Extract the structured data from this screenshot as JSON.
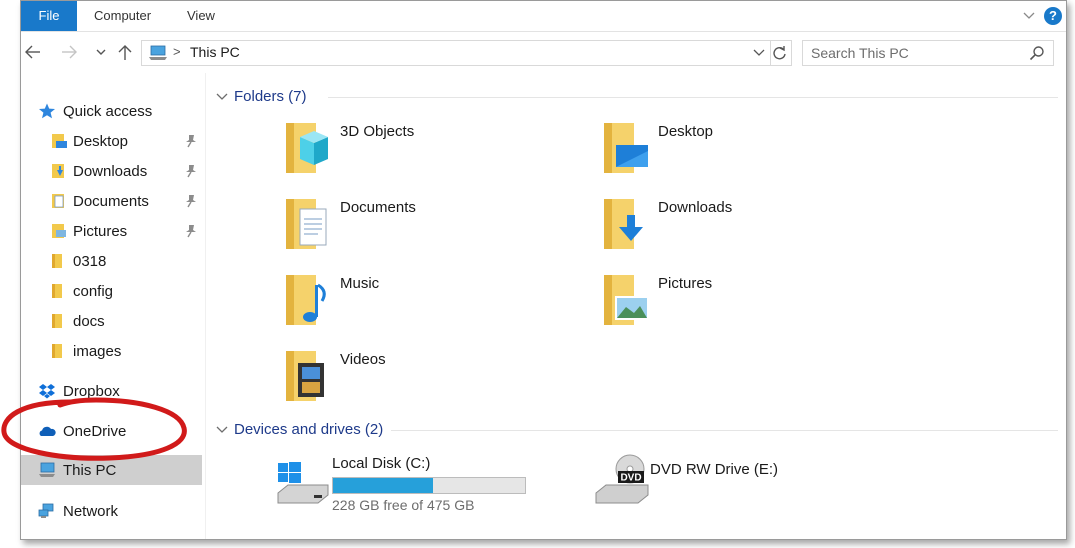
{
  "ribbon": {
    "tabs": [
      {
        "label": "File"
      },
      {
        "label": "Computer"
      },
      {
        "label": "View"
      }
    ],
    "help_label": "?"
  },
  "address": {
    "separator": ">",
    "path": "This PC"
  },
  "search": {
    "placeholder": "Search This PC"
  },
  "sidebar": {
    "items": [
      {
        "label": "Quick access"
      },
      {
        "label": "Desktop"
      },
      {
        "label": "Downloads"
      },
      {
        "label": "Documents"
      },
      {
        "label": "Pictures"
      },
      {
        "label": "0318"
      },
      {
        "label": "config"
      },
      {
        "label": "docs"
      },
      {
        "label": "images"
      },
      {
        "label": "Dropbox"
      },
      {
        "label": "OneDrive"
      },
      {
        "label": "This PC"
      },
      {
        "label": "Network"
      }
    ]
  },
  "folders": {
    "title": "Folders (7)",
    "items": [
      {
        "name": "3D Objects"
      },
      {
        "name": "Desktop"
      },
      {
        "name": "Documents"
      },
      {
        "name": "Downloads"
      },
      {
        "name": "Music"
      },
      {
        "name": "Pictures"
      },
      {
        "name": "Videos"
      }
    ]
  },
  "devices": {
    "title": "Devices and drives (2)",
    "items": [
      {
        "name": "Local Disk (C:)",
        "free": "228 GB free of 475 GB",
        "used_fraction": 0.52
      },
      {
        "name": "DVD RW Drive (E:)",
        "disc_label": "DVD"
      }
    ]
  },
  "colors": {
    "accent": "#1979ca",
    "drive_bar": "#26a0da",
    "annotation": "#d11a1a",
    "selected": "#cfcfcf"
  }
}
